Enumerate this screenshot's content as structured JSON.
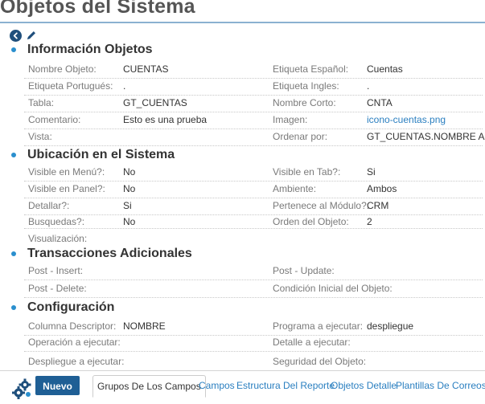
{
  "page": {
    "title": "Objetos del Sistema"
  },
  "toolbar": {
    "back_icon": "back-icon",
    "edit_icon": "pencil-icon"
  },
  "sections": {
    "info": {
      "title": "Información Objetos",
      "rows": [
        {
          "l1": "Nombre Objeto:",
          "v1": "CUENTAS",
          "l2": "Etiqueta Español:",
          "v2": "Cuentas"
        },
        {
          "l1": "Etiqueta Portugués:",
          "v1": ".",
          "l2": "Etiqueta Ingles:",
          "v2": "."
        },
        {
          "l1": "Tabla:",
          "v1": "GT_CUENTAS",
          "l2": "Nombre Corto:",
          "v2": "CNTA"
        },
        {
          "l1": "Comentario:",
          "v1": "Esto es una prueba",
          "l2": "Imagen:",
          "v2": "icono-cuentas.png"
        },
        {
          "l1": "Vista:",
          "v1": "",
          "l2": "Ordenar por:",
          "v2": "GT_CUENTAS.NOMBRE ASC"
        }
      ]
    },
    "ubicacion": {
      "title": "Ubicación en el Sistema",
      "rows": [
        {
          "l1": "Visible en Menú?:",
          "v1": "No",
          "l2": "Visible en Tab?:",
          "v2": "Si"
        },
        {
          "l1": "Visible en Panel?:",
          "v1": "No",
          "l2": "Ambiente:",
          "v2": "Ambos"
        },
        {
          "l1": "Detallar?:",
          "v1": "Si",
          "l2": "Pertenece al Módulo?:",
          "v2": "CRM"
        },
        {
          "l1": "Busquedas?:",
          "v1": "No",
          "l2": "Orden del Objeto:",
          "v2": "2"
        },
        {
          "l1": "Visualización:",
          "v1": "",
          "l2": "",
          "v2": ""
        }
      ]
    },
    "transacciones": {
      "title": "Transacciones Adicionales",
      "rows": [
        {
          "l1": "Post - Insert:",
          "v1": "",
          "l2": "Post - Update:",
          "v2": ""
        },
        {
          "l1": "Post - Delete:",
          "v1": "",
          "l2": "Condición Inicial del Objeto:",
          "v2": ""
        }
      ]
    },
    "configuracion": {
      "title": "Configuración",
      "rows": [
        {
          "l1": "Columna Descriptor:",
          "v1": "NOMBRE",
          "l2": "Programa a ejecutar:",
          "v2": "despliegue"
        },
        {
          "l1": "Operación a ejecutar:",
          "v1": "",
          "l2": "Detalle a ejecutar:",
          "v2": ""
        },
        {
          "l1": "Despliegue a ejecutar:",
          "v1": "",
          "l2": "Seguridad del Objeto:",
          "v2": ""
        }
      ]
    }
  },
  "bottom": {
    "gears_icon": "gears-icon",
    "nuevo_label": "Nuevo",
    "tabs": [
      "Grupos De Los Campos",
      "Campos",
      "Estructura Del Reporte",
      "Objetos Detalle",
      "Plantillas De Correos"
    ]
  },
  "colors": {
    "accent": "#2a8fce",
    "button": "#1f5f95",
    "link": "#2a7fc0",
    "title": "#555555"
  }
}
